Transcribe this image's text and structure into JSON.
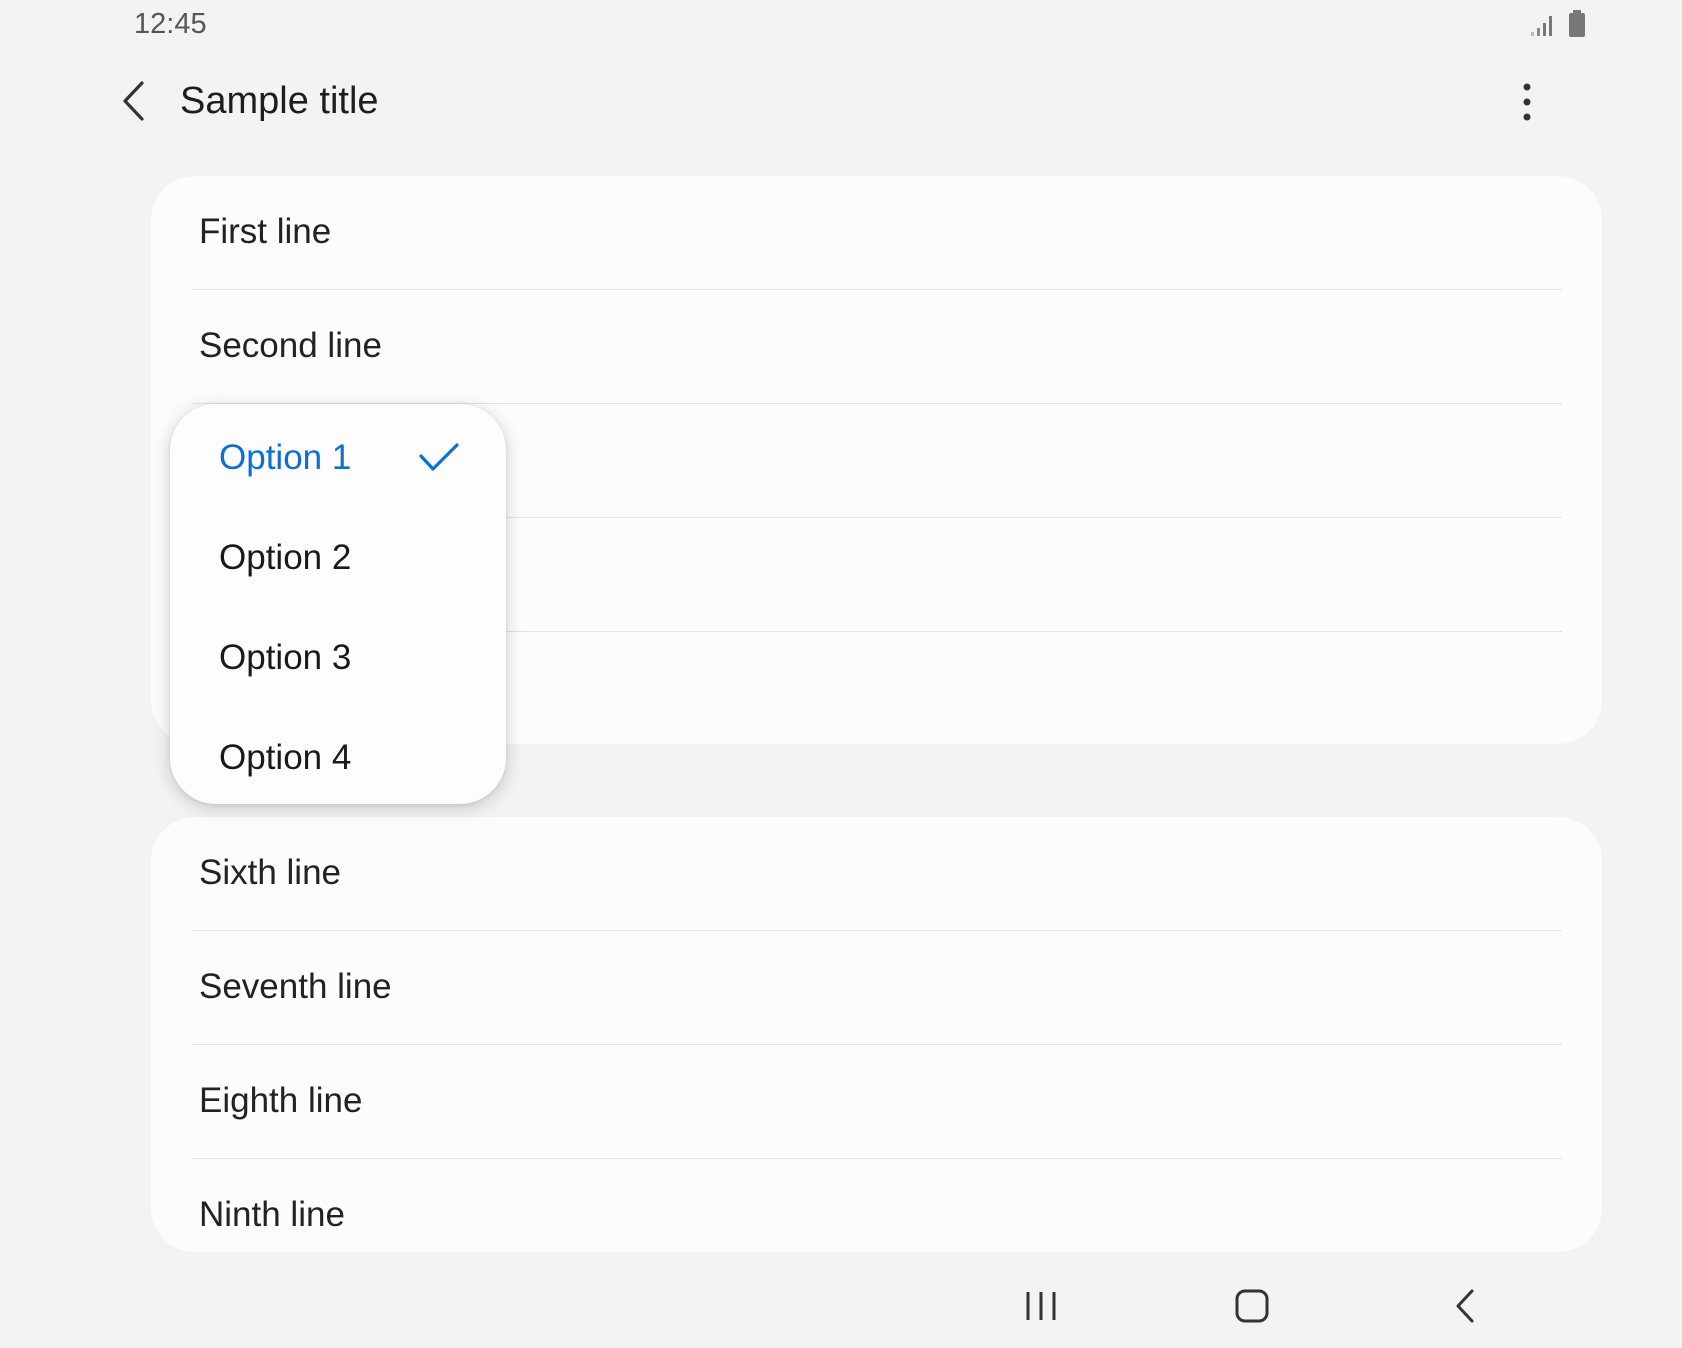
{
  "status_bar": {
    "time": "12:45",
    "icons": [
      "signal-icon",
      "battery-icon"
    ]
  },
  "app_bar": {
    "title": "Sample title",
    "back_icon": "back-arrow-icon",
    "more_icon": "more-vertical-icon"
  },
  "list_group_1": {
    "items": [
      {
        "label": "First line"
      },
      {
        "label": "Second line"
      },
      {
        "label": ""
      },
      {
        "label": ""
      },
      {
        "label": ""
      }
    ]
  },
  "list_group_2": {
    "items": [
      {
        "label": "Sixth line"
      },
      {
        "label": "Seventh line"
      },
      {
        "label": "Eighth line"
      },
      {
        "label": "Ninth line"
      }
    ]
  },
  "popup_menu": {
    "options": [
      {
        "label": "Option 1",
        "selected": true
      },
      {
        "label": "Option 2",
        "selected": false
      },
      {
        "label": "Option 3",
        "selected": false
      },
      {
        "label": "Option 4",
        "selected": false
      }
    ],
    "selected_color": "#0b6fd6",
    "check_icon": "checkmark-icon"
  },
  "nav_bar": {
    "buttons": [
      "recent-apps-icon",
      "home-icon",
      "back-icon"
    ]
  }
}
